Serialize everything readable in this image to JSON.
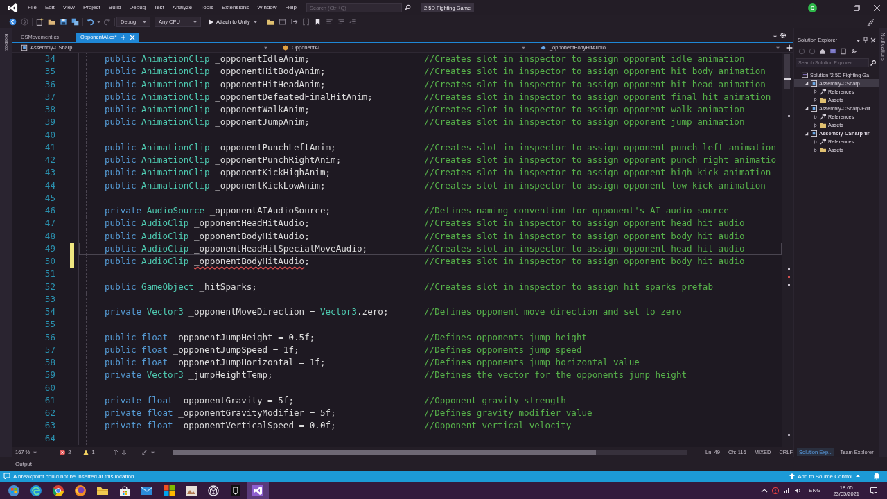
{
  "title_bar": {
    "menu": [
      "File",
      "Edit",
      "View",
      "Project",
      "Build",
      "Debug",
      "Test",
      "Analyze",
      "Tools",
      "Extensions",
      "Window",
      "Help"
    ],
    "search": {
      "placeholder": "Search (Ctrl+Q)"
    },
    "solution_name": "2.5D Fighting Game",
    "account_initial": "C"
  },
  "toolbar": {
    "configuration": "Debug",
    "platform": "Any CPU",
    "run_target": "Attach to Unity"
  },
  "side_tabs": {
    "left": "Toolbox",
    "right": "Notifications"
  },
  "document_tabs": [
    {
      "label": "CSMovement.cs",
      "selected": false
    },
    {
      "label": "OpponentAI.cs*",
      "selected": true
    }
  ],
  "navigation_bar": {
    "project": "Assembly-CSharp",
    "class": "OpponentAI",
    "member": "_opponentBodyHitAudio"
  },
  "editor": {
    "lines": [
      {
        "number": "34",
        "code": [
          {
            "kind": "keyword",
            "text": "public"
          },
          {
            "kind": "type",
            "text": "AnimationClip"
          },
          {
            "kind": "plain",
            "text": "_opponentIdleAnim;"
          }
        ],
        "comment": "//Creates slot in inspector to assign opponent idle animation",
        "modified": false,
        "current": false
      },
      {
        "number": "35",
        "code": [
          {
            "kind": "keyword",
            "text": "public"
          },
          {
            "kind": "type",
            "text": "AnimationClip"
          },
          {
            "kind": "plain",
            "text": "_opponentHitBodyAnim;"
          }
        ],
        "comment": "//Creates slot in inspector to assign opponent hit body animation",
        "modified": false,
        "current": false
      },
      {
        "number": "36",
        "code": [
          {
            "kind": "keyword",
            "text": "public"
          },
          {
            "kind": "type",
            "text": "AnimationClip"
          },
          {
            "kind": "plain",
            "text": "_opponentHitHeadAnim;"
          }
        ],
        "comment": "//Creates slot in inspector to assign opponent hit head animation",
        "modified": false,
        "current": false
      },
      {
        "number": "37",
        "code": [
          {
            "kind": "keyword",
            "text": "public"
          },
          {
            "kind": "type",
            "text": "AnimationClip"
          },
          {
            "kind": "plain",
            "text": "_opponentDefeatedFinalHitAnim;"
          }
        ],
        "comment": "//Creates slot in inspector to assign opponent final hit animation",
        "modified": false,
        "current": false
      },
      {
        "number": "38",
        "code": [
          {
            "kind": "keyword",
            "text": "public"
          },
          {
            "kind": "type",
            "text": "AnimationClip"
          },
          {
            "kind": "plain",
            "text": "_opponentWalkAnim;"
          }
        ],
        "comment": "//Creates slot in inspector to assign opponent walk animation",
        "modified": false,
        "current": false
      },
      {
        "number": "39",
        "code": [
          {
            "kind": "keyword",
            "text": "public"
          },
          {
            "kind": "type",
            "text": "AnimationClip"
          },
          {
            "kind": "plain",
            "text": "_opponentJumpAnim;"
          }
        ],
        "comment": "//Creates slot in inspector to assign opponent jump animation",
        "modified": false,
        "current": false
      },
      {
        "number": "40",
        "modified": false,
        "current": false
      },
      {
        "number": "41",
        "code": [
          {
            "kind": "keyword",
            "text": "public"
          },
          {
            "kind": "type",
            "text": "AnimationClip"
          },
          {
            "kind": "plain",
            "text": "_opponentPunchLeftAnim;"
          }
        ],
        "comment": "//Creates slot in inspector to assign opponent punch left animation",
        "modified": false,
        "current": false
      },
      {
        "number": "42",
        "code": [
          {
            "kind": "keyword",
            "text": "public"
          },
          {
            "kind": "type",
            "text": "AnimationClip"
          },
          {
            "kind": "plain",
            "text": "_opponentPunchRightAnim;"
          }
        ],
        "comment": "//Creates slot in inspector to assign opponent punch right animatio",
        "modified": false,
        "current": false
      },
      {
        "number": "43",
        "code": [
          {
            "kind": "keyword",
            "text": "public"
          },
          {
            "kind": "type",
            "text": "AnimationClip"
          },
          {
            "kind": "plain",
            "text": "_opponentKickHighAnim;"
          }
        ],
        "comment": "//Creates slot in inspector to assign opponent high kick animation",
        "modified": false,
        "current": false
      },
      {
        "number": "44",
        "code": [
          {
            "kind": "keyword",
            "text": "public"
          },
          {
            "kind": "type",
            "text": "AnimationClip"
          },
          {
            "kind": "plain",
            "text": "_opponentKickLowAnim;"
          }
        ],
        "comment": "//Creates slot in inspector to assign opponent low kick animation",
        "modified": false,
        "current": false
      },
      {
        "number": "45",
        "modified": false,
        "current": false
      },
      {
        "number": "46",
        "code": [
          {
            "kind": "keyword",
            "text": "private"
          },
          {
            "kind": "type",
            "text": "AudioSource"
          },
          {
            "kind": "plain",
            "text": "_opponentAIAudioSource;"
          }
        ],
        "comment": "//Defines naming convention for opponent's AI audio source",
        "modified": false,
        "current": false
      },
      {
        "number": "47",
        "code": [
          {
            "kind": "keyword",
            "text": "public"
          },
          {
            "kind": "type",
            "text": "AudioClip"
          },
          {
            "kind": "plain",
            "text": "_opponentHeadHitAudio;"
          }
        ],
        "comment": "//Creates slot in inspector to assign opponent head hit audio",
        "modified": false,
        "current": false
      },
      {
        "number": "48",
        "code": [
          {
            "kind": "keyword",
            "text": "public"
          },
          {
            "kind": "type",
            "text": "AudioClip"
          },
          {
            "kind": "plain",
            "text": "_opponentBodyHitAudio;"
          }
        ],
        "comment": "//Creates slot in inspector to assign opponent body hit audio",
        "modified": false,
        "current": false
      },
      {
        "number": "49",
        "code": [
          {
            "kind": "keyword",
            "text": "public"
          },
          {
            "kind": "type",
            "text": "AudioClip"
          },
          {
            "kind": "plain",
            "text": "_opponentHeadHitSpecialMoveAudio;"
          }
        ],
        "comment": "//Creates slot in inspector to assign opponent head hit audio",
        "modified": true,
        "current": true
      },
      {
        "number": "50",
        "code": [
          {
            "kind": "keyword",
            "text": "public"
          },
          {
            "kind": "type",
            "text": "AudioClip"
          },
          {
            "kind": "error",
            "text": "_opponentBodyHitAudio"
          },
          {
            "kind": "member",
            "text": ";"
          }
        ],
        "comment": "//Creates slot in inspector to assign opponent body hit audio",
        "modified": true,
        "current": false
      },
      {
        "number": "51",
        "modified": false,
        "current": false
      },
      {
        "number": "52",
        "code": [
          {
            "kind": "keyword",
            "text": "public"
          },
          {
            "kind": "type",
            "text": "GameObject"
          },
          {
            "kind": "plain",
            "text": "_hitSparks;"
          }
        ],
        "comment": "//Creates slot in inspector to assign hit sparks prefab",
        "modified": false,
        "current": false
      },
      {
        "number": "53",
        "modified": false,
        "current": false
      },
      {
        "number": "54",
        "code": [
          {
            "kind": "keyword",
            "text": "private"
          },
          {
            "kind": "type",
            "text": "Vector3"
          },
          {
            "kind": "plain",
            "text": "_opponentMoveDirection ="
          },
          {
            "kind": "type",
            "text": "Vector3"
          },
          {
            "kind": "member",
            "text": ".zero;"
          }
        ],
        "comment": "//Defines opponent move direction and set to zero",
        "modified": false,
        "current": false
      },
      {
        "number": "55",
        "modified": false,
        "current": false
      },
      {
        "number": "56",
        "code": [
          {
            "kind": "keyword",
            "text": "public"
          },
          {
            "kind": "keyword",
            "text": "float"
          },
          {
            "kind": "plain",
            "text": "_opponentJumpHeight = 0.5f;"
          }
        ],
        "comment": "//Defines opponents jump height",
        "modified": false,
        "current": false
      },
      {
        "number": "57",
        "code": [
          {
            "kind": "keyword",
            "text": "public"
          },
          {
            "kind": "keyword",
            "text": "float"
          },
          {
            "kind": "plain",
            "text": "_opponentJumpSpeed = 1f;"
          }
        ],
        "comment": "//Defines opponents jump speed",
        "modified": false,
        "current": false
      },
      {
        "number": "58",
        "code": [
          {
            "kind": "keyword",
            "text": "public"
          },
          {
            "kind": "keyword",
            "text": "float"
          },
          {
            "kind": "plain",
            "text": "_opponentJumpHorizontal = 1f;"
          }
        ],
        "comment": "//Defines opponents jump horizontal value",
        "modified": false,
        "current": false
      },
      {
        "number": "59",
        "code": [
          {
            "kind": "keyword",
            "text": "private"
          },
          {
            "kind": "type",
            "text": "Vector3"
          },
          {
            "kind": "plain",
            "text": "_jumpHeightTemp;"
          }
        ],
        "comment": "//Defines the vector for the opponents jump height",
        "modified": false,
        "current": false
      },
      {
        "number": "60",
        "modified": false,
        "current": false
      },
      {
        "number": "61",
        "code": [
          {
            "kind": "keyword",
            "text": "private"
          },
          {
            "kind": "keyword",
            "text": "float"
          },
          {
            "kind": "plain",
            "text": "_opponentGravity = 5f;"
          }
        ],
        "comment": "//Opponent gravity strength",
        "modified": false,
        "current": false
      },
      {
        "number": "62",
        "code": [
          {
            "kind": "keyword",
            "text": "private"
          },
          {
            "kind": "keyword",
            "text": "float"
          },
          {
            "kind": "plain",
            "text": "_opponentGravityModifier = 5f;"
          }
        ],
        "comment": "//Defines gravity modifier value",
        "modified": false,
        "current": false
      },
      {
        "number": "63",
        "code": [
          {
            "kind": "keyword",
            "text": "private"
          },
          {
            "kind": "keyword",
            "text": "float"
          },
          {
            "kind": "plain",
            "text": "_opponentVerticalSpeed = 0.0f;"
          }
        ],
        "comment": "//Opponent vertical velocity",
        "modified": false,
        "current": false
      },
      {
        "number": "64",
        "modified": false,
        "current": false
      }
    ]
  },
  "editor_status": {
    "zoom": "167 %",
    "errors": "2",
    "warnings": "1",
    "line": "Ln: 49",
    "column": "Ch: 116",
    "whitespace": "MIXED",
    "line_endings": "CRLF"
  },
  "solution_explorer": {
    "title": "Solution Explorer",
    "search": {
      "placeholder": "Search Solution Explorer"
    },
    "tree": [
      {
        "kind": "solution",
        "label": "Solution '2.5D Fighting Ga",
        "selected": false,
        "children": [
          {
            "kind": "project",
            "label": "Assembly-CSharp",
            "selected": true,
            "expanded": true,
            "startup": false,
            "children": [
              {
                "kind": "references",
                "label": "References",
                "selected": false,
                "expanded": false
              },
              {
                "kind": "folder",
                "label": "Assets",
                "selected": false,
                "expanded": false
              }
            ]
          },
          {
            "kind": "project",
            "label": "Assembly-CSharp-Edit",
            "selected": false,
            "expanded": true,
            "startup": false,
            "children": [
              {
                "kind": "references",
                "label": "References",
                "selected": false,
                "expanded": false
              },
              {
                "kind": "folder",
                "label": "Assets",
                "selected": false,
                "expanded": false
              }
            ]
          },
          {
            "kind": "project",
            "label": "Assembly-CSharp-fir",
            "selected": false,
            "expanded": true,
            "startup": true,
            "children": [
              {
                "kind": "references",
                "label": "References",
                "selected": false,
                "expanded": false
              },
              {
                "kind": "folder",
                "label": "Assets",
                "selected": false,
                "expanded": false
              }
            ]
          }
        ]
      }
    ]
  },
  "panel_tabs": [
    {
      "label": "Solution Exp...",
      "selected": true
    },
    {
      "label": "Team Explorer",
      "selected": false
    }
  ],
  "output_tab": "Output",
  "status_bar": {
    "message": "A breakpoint could not be inserted at this location.",
    "source_control": "Add to Source Control"
  },
  "taskbar": {
    "apps": [
      {
        "kind": "start",
        "selected": false
      },
      {
        "kind": "edge",
        "selected": false
      },
      {
        "kind": "chrome",
        "selected": false
      },
      {
        "kind": "firefox",
        "selected": false
      },
      {
        "kind": "explorer",
        "selected": false
      },
      {
        "kind": "store",
        "selected": false
      },
      {
        "kind": "mail",
        "selected": false
      },
      {
        "kind": "office",
        "selected": false
      },
      {
        "kind": "photos",
        "selected": false
      },
      {
        "kind": "unity",
        "selected": false
      },
      {
        "kind": "terminal",
        "selected": false
      },
      {
        "kind": "studio",
        "selected": true
      }
    ],
    "language": "ENG",
    "time": "18:05",
    "date": "23/05/2021"
  }
}
